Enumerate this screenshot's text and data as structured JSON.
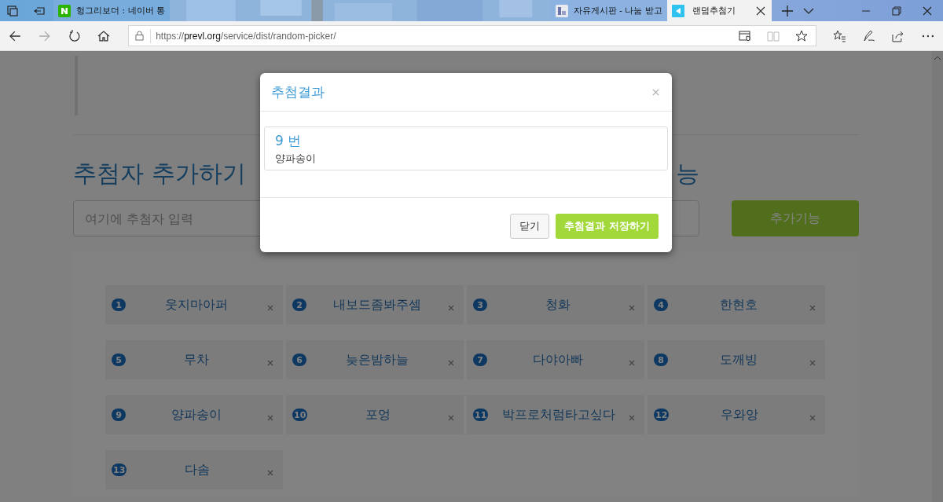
{
  "browser": {
    "tabs": [
      {
        "title": "헝그리보더 : 네이버 통",
        "selected": false,
        "kind": "naver"
      },
      {
        "title": "자유게시판 - 나눔 받고",
        "selected": false,
        "kind": "board"
      },
      {
        "title": "랜덤추첨기",
        "selected": true,
        "kind": "app"
      }
    ],
    "url": {
      "scheme": "https://",
      "host": "prevl.org",
      "path": "/service/dist/random-picker/"
    }
  },
  "page": {
    "heading_start": "추첨자 추가하기",
    "heading_end": "능",
    "input": {
      "placeholder": "여기에 추첨자 입력"
    },
    "add_button": "추가기능",
    "participants": [
      {
        "number": "1",
        "name": "웃지마아퍼"
      },
      {
        "number": "2",
        "name": "내보드좀봐주셈"
      },
      {
        "number": "3",
        "name": "청화"
      },
      {
        "number": "4",
        "name": "한현호"
      },
      {
        "number": "5",
        "name": "무차"
      },
      {
        "number": "6",
        "name": "늦은밤하늘"
      },
      {
        "number": "7",
        "name": "다야아빠"
      },
      {
        "number": "8",
        "name": "도깨빙"
      },
      {
        "number": "9",
        "name": "양파송이"
      },
      {
        "number": "10",
        "name": "포엉"
      },
      {
        "number": "11",
        "name": "박프로처럼타고싶다"
      },
      {
        "number": "12",
        "name": "우와앙"
      },
      {
        "number": "13",
        "name": "다솜"
      }
    ]
  },
  "modal": {
    "title": "추첨결과",
    "result_number": "9 번",
    "result_name": "양파송이",
    "buttons": [
      {
        "label": "닫기",
        "kind": "default"
      },
      {
        "label": "추첨결과 저장하기",
        "kind": "primary"
      }
    ]
  }
}
